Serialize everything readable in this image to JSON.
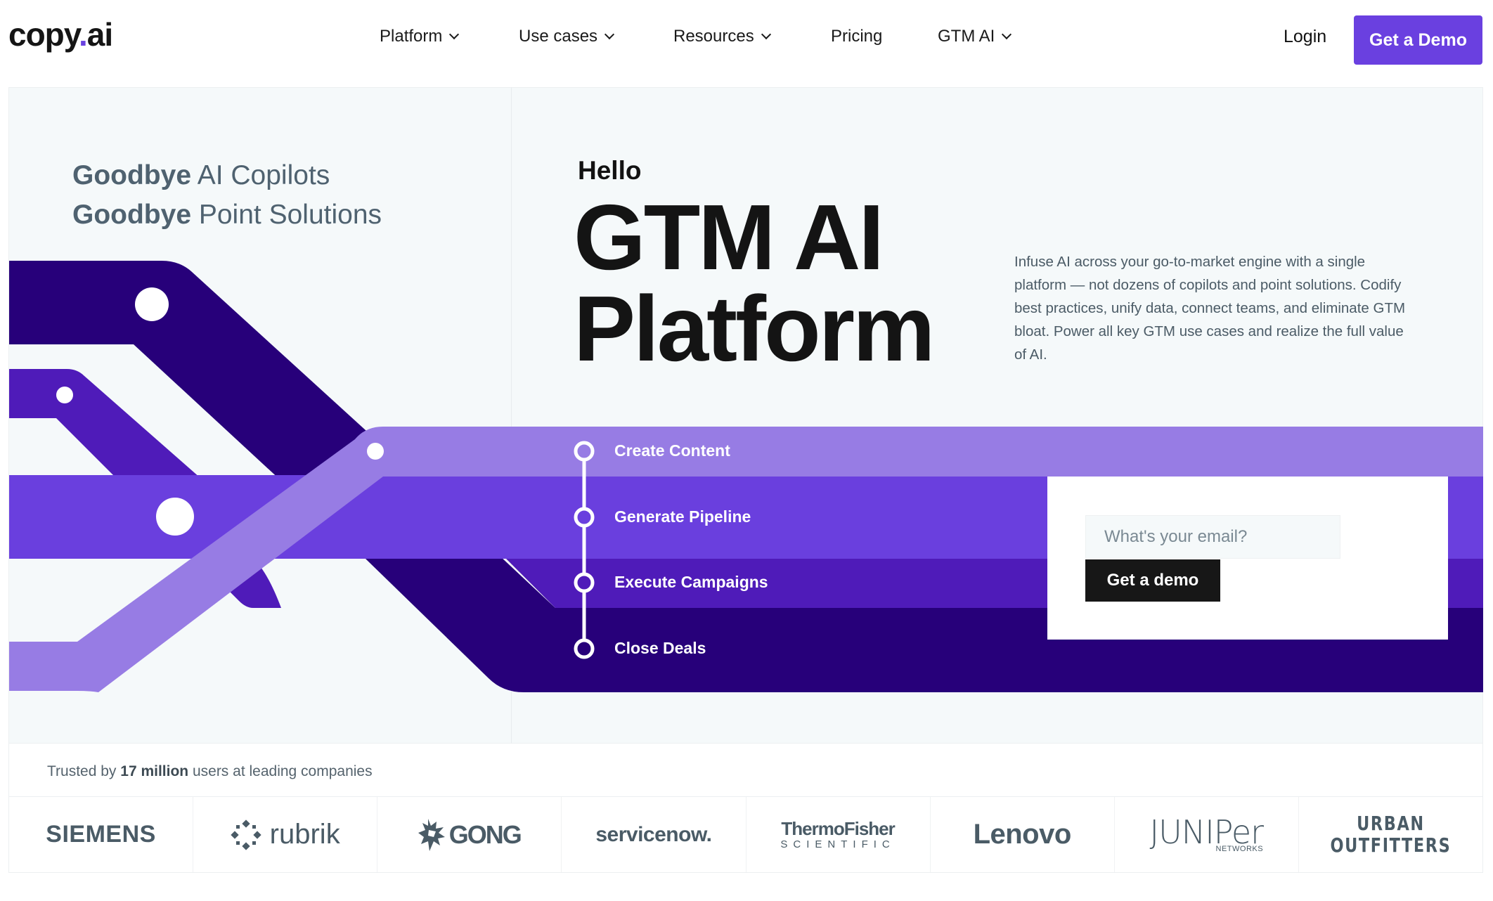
{
  "header": {
    "logo": {
      "text": "copy",
      "dot": ".",
      "suffix": "ai"
    },
    "nav": [
      {
        "label": "Platform",
        "dropdown": true
      },
      {
        "label": "Use cases",
        "dropdown": true
      },
      {
        "label": "Resources",
        "dropdown": true
      },
      {
        "label": "Pricing",
        "dropdown": false
      },
      {
        "label": "GTM AI",
        "dropdown": true
      }
    ],
    "login_label": "Login",
    "cta_label": "Get a Demo"
  },
  "hero": {
    "goodbye_lines": [
      {
        "bold": "Goodbye",
        "rest": " AI Copilots"
      },
      {
        "bold": "Goodbye",
        "rest": " Point Solutions"
      }
    ],
    "hello": "Hello",
    "title_lines": [
      "GTM AI",
      "Platform"
    ],
    "description": "Infuse AI across your go-to-market engine with a single platform — not dozens of copilots and point solutions. Codify best practices, unify data, connect teams, and eliminate GTM bloat. Power all key GTM use cases and realize the full value of AI.",
    "steps": [
      "Create Content",
      "Generate Pipeline",
      "Execute Campaigns",
      "Close Deals"
    ],
    "form": {
      "email_placeholder": "What's your email?",
      "email_value": "",
      "submit_label": "Get a demo"
    }
  },
  "trusted": {
    "prefix": "Trusted by ",
    "highlight": "17 million",
    "suffix": " users at leading companies"
  },
  "logos": [
    {
      "name": "siemens",
      "text": "SIEMENS"
    },
    {
      "name": "rubrik",
      "text": "rubrik"
    },
    {
      "name": "gong",
      "text": "GONG"
    },
    {
      "name": "servicenow",
      "text": "servicenow."
    },
    {
      "name": "thermo-fisher",
      "text": "ThermoFisher",
      "subtext": "SCIENTIFIC"
    },
    {
      "name": "lenovo",
      "text": "Lenovo"
    },
    {
      "name": "juniper",
      "text": "JUNIPer",
      "subtext": "NETWORKS"
    },
    {
      "name": "urban-outfitters",
      "text": "URBAN",
      "subtext": "OUTFITTERS"
    }
  ],
  "colors": {
    "brand_purple": "#6a40e0",
    "band_light": "#977ce4",
    "band_mid": "#6a3fde",
    "band_deep": "#4f1bb9",
    "band_darkest": "#27007a",
    "hero_bg": "#f5f9fa",
    "text_muted": "#4f6270"
  }
}
